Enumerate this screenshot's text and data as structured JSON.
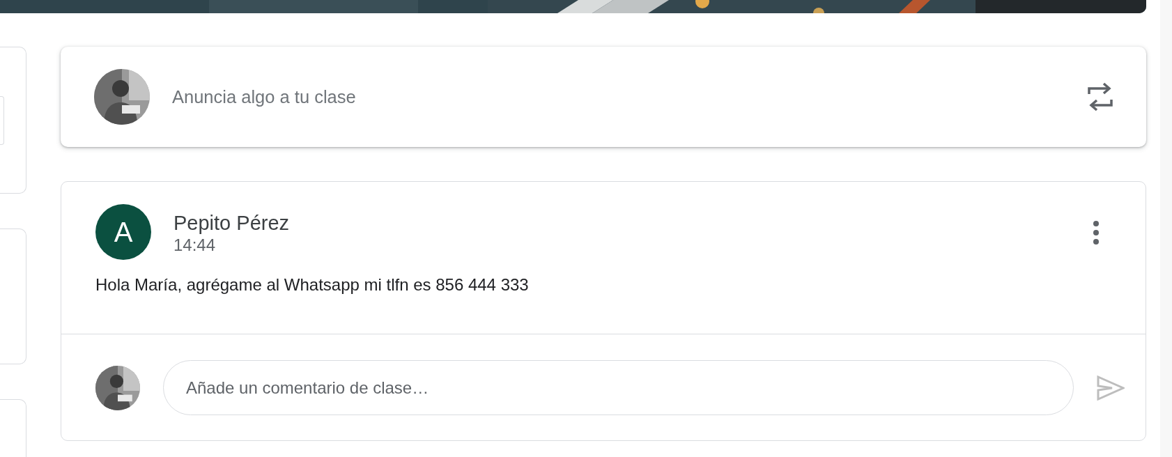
{
  "announce": {
    "placeholder": "Anuncia algo a tu clase"
  },
  "post": {
    "author": "Pepito Pérez",
    "avatar_letter": "A",
    "time": "14:44",
    "text": "Hola María, agrégame al Whatsapp mi tlfn es 856 444 333",
    "comment": {
      "placeholder": "Añade un comentario de clase…"
    }
  }
}
